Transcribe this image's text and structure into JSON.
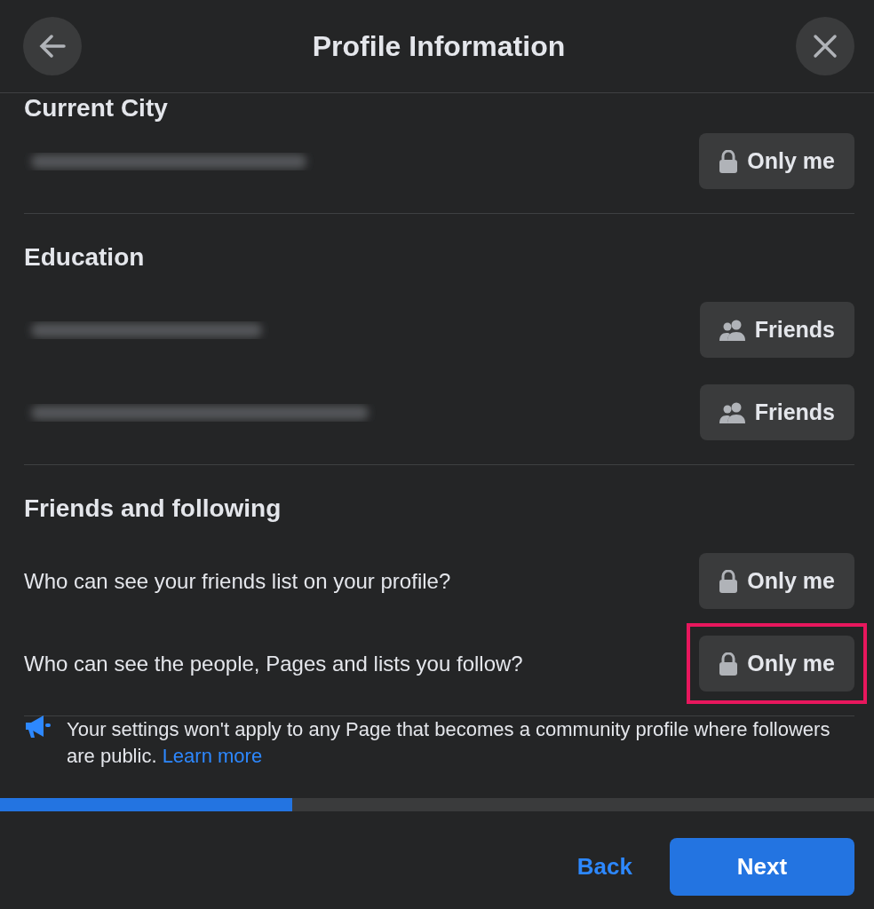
{
  "header": {
    "title": "Profile Information"
  },
  "sections": [
    {
      "title": "Current City",
      "rows": [
        {
          "kind": "redacted",
          "audience": {
            "kind": "private",
            "label": "Only me"
          },
          "highlighted": false
        }
      ]
    },
    {
      "title": "Education",
      "rows": [
        {
          "kind": "redacted",
          "audience": {
            "kind": "friends",
            "label": "Friends"
          },
          "highlighted": false
        },
        {
          "kind": "redacted",
          "audience": {
            "kind": "friends",
            "label": "Friends"
          },
          "highlighted": false
        }
      ]
    },
    {
      "title": "Friends and following",
      "rows": [
        {
          "kind": "question",
          "text": "Who can see your friends list on your profile?",
          "audience": {
            "kind": "private",
            "label": "Only me"
          },
          "highlighted": false
        },
        {
          "kind": "question",
          "text": "Who can see the people, Pages and lists you follow?",
          "audience": {
            "kind": "private",
            "label": "Only me"
          },
          "highlighted": true
        }
      ]
    }
  ],
  "notice": {
    "text": "Your settings won't apply to any Page that becomes a community profile where followers are public.",
    "link": "Learn more"
  },
  "progress": {
    "level": 0.334
  },
  "footer": {
    "back": "Back",
    "next": "Next"
  }
}
